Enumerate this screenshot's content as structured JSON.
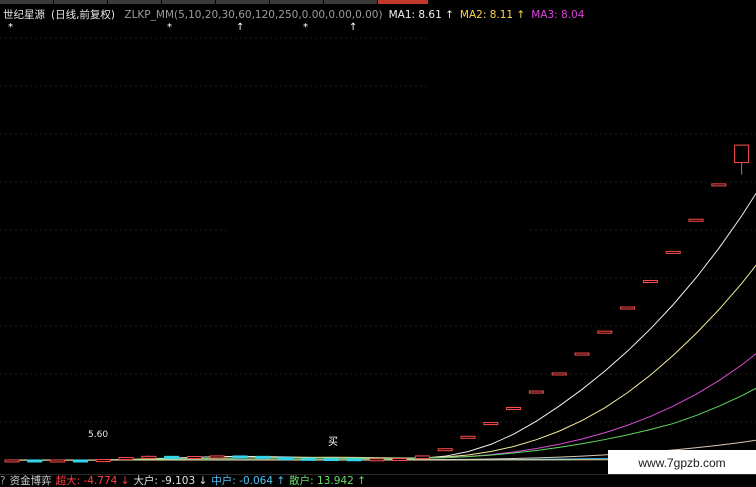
{
  "tabs": [
    {
      "label": ""
    },
    {
      "label": ""
    },
    {
      "label": ""
    },
    {
      "label": ""
    },
    {
      "label": ""
    },
    {
      "label": ""
    },
    {
      "label": ""
    },
    {
      "label": ""
    },
    {
      "label": ""
    },
    {
      "label": ""
    },
    {
      "label": ""
    },
    {
      "label": ""
    },
    {
      "label": ""
    },
    {
      "label": ""
    }
  ],
  "active_tab_index": 7,
  "legend": {
    "stock": "世纪星源",
    "period": "(日线,前复权)",
    "indicator": "ZLKP_MM(5,10,20,30,60,120,250,0.00,0.00,0.00)",
    "ma1": "MA1: 8.61 ↑",
    "ma2": "MA2: 8.11 ↑",
    "ma3": "MA3: 8.04"
  },
  "markers": {
    "star": "*",
    "arrow": "↑"
  },
  "price_label": "5.60",
  "buy_label": "买",
  "bottom": {
    "qmark": "?",
    "indicator_name": "资金博弈",
    "super": "超大: -4.774 ↓",
    "big": "大户: -9.103 ↓",
    "mid": "中户: -0.064 ↑",
    "small": "散户: 13.942 ↑"
  },
  "watermark": "www.7gpzb.com",
  "colors": {
    "up": "#ff4d4d",
    "down": "#35d6ea",
    "ma1": "#f2f2f2",
    "ma2": "#f3eb9a",
    "ma3": "#d84cd8",
    "ma4": "#5fdc5f",
    "ma5": "#d8c8b8",
    "ma6": "#4aa8d8",
    "ma7": "#eee8aa"
  },
  "chart_data": {
    "type": "candlestick",
    "title": "世纪星源 (日线,前复权)",
    "series": [
      {
        "name": "MA1",
        "last": 8.61
      },
      {
        "name": "MA2",
        "last": 8.11
      },
      {
        "name": "MA3",
        "last": 8.04
      }
    ],
    "candles": [
      {
        "o": 5.58,
        "c": 5.6,
        "h": 5.62,
        "l": 5.56
      },
      {
        "o": 5.6,
        "c": 5.59,
        "h": 5.61,
        "l": 5.57
      },
      {
        "o": 5.59,
        "c": 5.6,
        "h": 5.61,
        "l": 5.58
      },
      {
        "o": 5.6,
        "c": 5.58,
        "h": 5.61,
        "l": 5.57
      },
      {
        "o": 5.58,
        "c": 5.62,
        "h": 5.64,
        "l": 5.57
      },
      {
        "o": 5.62,
        "c": 5.72,
        "h": 5.74,
        "l": 5.61
      },
      {
        "o": 5.72,
        "c": 5.78,
        "h": 5.82,
        "l": 5.7
      },
      {
        "o": 5.78,
        "c": 5.76,
        "h": 5.8,
        "l": 5.74
      },
      {
        "o": 5.76,
        "c": 5.77,
        "h": 5.79,
        "l": 5.74
      },
      {
        "o": 5.77,
        "c": 5.8,
        "h": 5.83,
        "l": 5.75
      },
      {
        "o": 5.8,
        "c": 5.78,
        "h": 5.81,
        "l": 5.76
      },
      {
        "o": 5.78,
        "c": 5.72,
        "h": 5.79,
        "l": 5.7
      },
      {
        "o": 5.72,
        "c": 5.68,
        "h": 5.73,
        "l": 5.66
      },
      {
        "o": 5.68,
        "c": 5.67,
        "h": 5.69,
        "l": 5.65
      },
      {
        "o": 5.67,
        "c": 5.66,
        "h": 5.68,
        "l": 5.64
      },
      {
        "o": 5.66,
        "c": 5.65,
        "h": 5.67,
        "l": 5.63
      },
      {
        "o": 5.65,
        "c": 5.66,
        "h": 5.67,
        "l": 5.63
      },
      {
        "o": 5.66,
        "c": 5.67,
        "h": 5.68,
        "l": 5.65
      },
      {
        "o": 5.67,
        "c": 5.8,
        "h": 5.81,
        "l": 5.66
      },
      {
        "o": 6.16,
        "c": 6.16,
        "h": 6.16,
        "l": 6.16
      },
      {
        "o": 6.78,
        "c": 6.78,
        "h": 6.78,
        "l": 6.78
      },
      {
        "o": 7.46,
        "c": 7.46,
        "h": 7.46,
        "l": 7.46
      },
      {
        "o": 8.21,
        "c": 8.21,
        "h": 8.21,
        "l": 8.21
      },
      {
        "o": 9.03,
        "c": 9.03,
        "h": 9.03,
        "l": 9.03
      },
      {
        "o": 9.93,
        "c": 9.93,
        "h": 9.93,
        "l": 9.93
      },
      {
        "o": 10.92,
        "c": 10.92,
        "h": 10.92,
        "l": 10.92
      },
      {
        "o": 12.01,
        "c": 12.01,
        "h": 12.01,
        "l": 12.01
      },
      {
        "o": 13.21,
        "c": 13.21,
        "h": 13.21,
        "l": 13.21
      },
      {
        "o": 14.53,
        "c": 14.53,
        "h": 14.53,
        "l": 14.53
      },
      {
        "o": 15.98,
        "c": 15.98,
        "h": 15.98,
        "l": 15.98
      },
      {
        "o": 17.58,
        "c": 17.58,
        "h": 17.58,
        "l": 17.58
      },
      {
        "o": 19.34,
        "c": 19.34,
        "h": 19.34,
        "l": 19.34
      },
      {
        "o": 20.4,
        "c": 21.27,
        "h": 21.27,
        "l": 19.8
      },
      {
        "o": 23.4,
        "c": 23.4,
        "h": 23.4,
        "l": 23.4
      },
      {
        "o": 25.7,
        "c": 24.3,
        "h": 26.2,
        "l": 24.0
      }
    ],
    "ylim": [
      5.2,
      26.5
    ]
  }
}
